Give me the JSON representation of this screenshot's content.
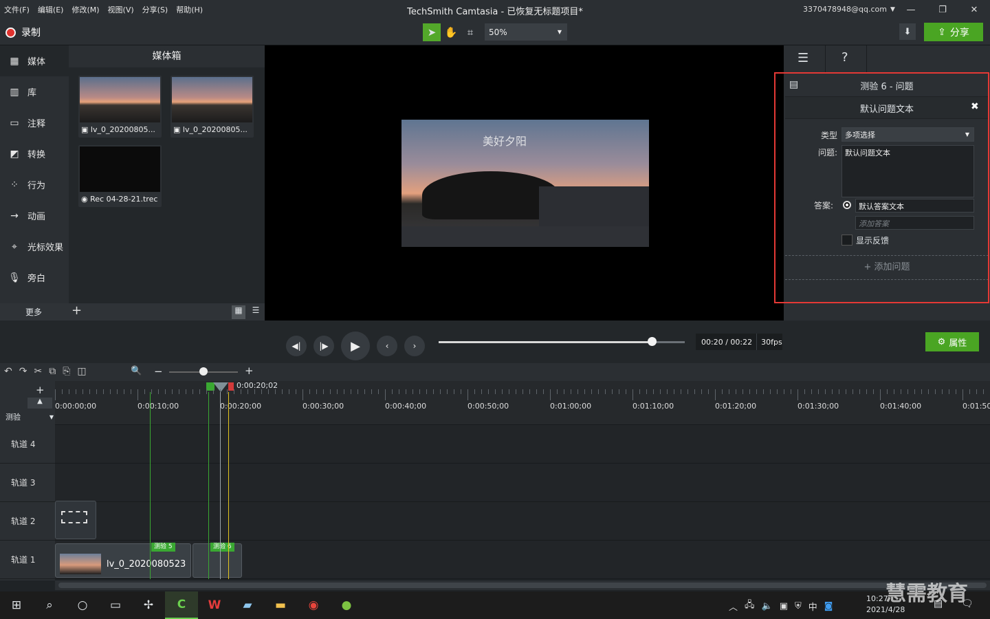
{
  "menu": [
    "文件(F)",
    "编辑(E)",
    "修改(M)",
    "视图(V)",
    "分享(S)",
    "帮助(H)"
  ],
  "window_title": "TechSmith Camtasia - 已恢复无标题项目*",
  "account": "3370478948@qq.com",
  "record_label": "录制",
  "zoom": "50%",
  "share_label": "分享",
  "left_nav": [
    "媒体",
    "库",
    "注释",
    "转换",
    "行为",
    "动画",
    "光标效果",
    "旁白"
  ],
  "more_label": "更多",
  "bin": {
    "title": "媒体箱",
    "items": [
      "lv_0_20200805...",
      "lv_0_20200805...",
      "Rec 04-28-21.trec"
    ]
  },
  "video_caption": "美好夕阳",
  "quiz": {
    "title": "测验 6 - 问题",
    "subtitle": "默认问题文本",
    "type_label": "类型",
    "type_value": "多项选择",
    "question_label": "问题:",
    "question_value": "默认问题文本",
    "answer_label": "答案:",
    "answer_value": "默认答案文本",
    "add_answer_placeholder": "添加答案",
    "feedback_label": "显示反馈",
    "add_question": "+ 添加问题"
  },
  "help_glyph": "?",
  "time": "00:20 / 00:22",
  "fps": "30fps",
  "props_label": "属性",
  "timeline": {
    "playhead": "0:00:20;02",
    "quiz_track": "测验",
    "ticks": [
      "0:00:00;00",
      "0:00:10;00",
      "0:00:20;00",
      "0:00:30;00",
      "0:00:40;00",
      "0:00:50;00",
      "0:01:00;00",
      "0:01:10;00",
      "0:01:20;00",
      "0:01:30;00",
      "0:01:40;00",
      "0:01:50;"
    ],
    "tracks": [
      "轨道 4",
      "轨道 3",
      "轨道 2",
      "轨道 1"
    ],
    "clip_label": "lv_0_2020080523",
    "marker1": "测验 5",
    "marker2": "测验 6"
  },
  "taskbar": {
    "time": "10:27",
    "date": "2021/4/28",
    "ime": "中"
  },
  "watermark": "慧需教育"
}
